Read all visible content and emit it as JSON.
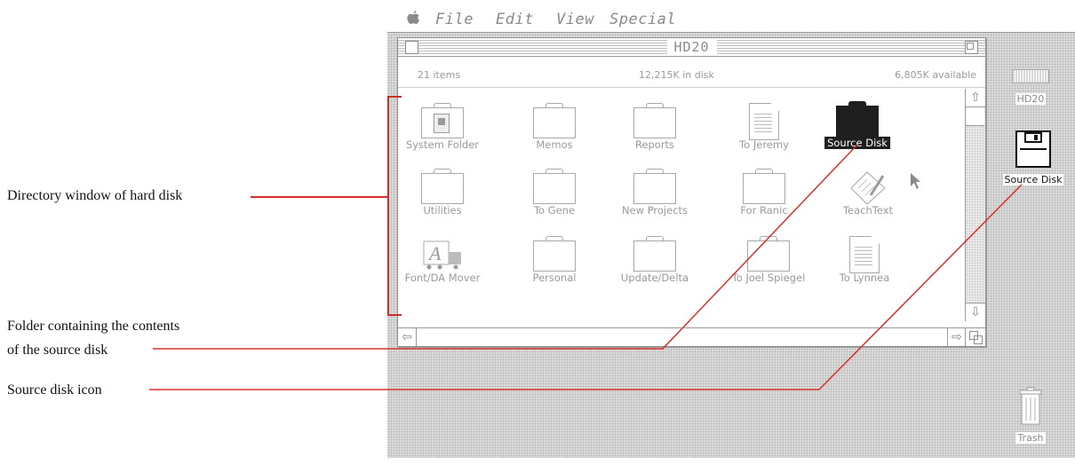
{
  "callouts": {
    "directory": "Directory window of hard disk",
    "folder_line1": "Folder containing the contents",
    "folder_line2": "of the source disk",
    "source_icon": "Source disk icon"
  },
  "menubar": {
    "apple_icon": "apple-logo-icon",
    "items": [
      "File",
      "Edit",
      "View",
      "Special"
    ]
  },
  "window": {
    "title": "HD20",
    "info": {
      "items": "21 items",
      "in_disk": "12,215K in disk",
      "available": "6,805K available"
    },
    "icons": [
      {
        "label": "System Folder",
        "icon": "system-folder-icon"
      },
      {
        "label": "Memos",
        "icon": "folder-icon"
      },
      {
        "label": "Reports",
        "icon": "folder-icon"
      },
      {
        "label": "To Jeremy",
        "icon": "document-icon"
      },
      {
        "label": "Source Disk",
        "icon": "folder-icon",
        "selected": true
      },
      {
        "label": "Utilities",
        "icon": "folder-icon"
      },
      {
        "label": "To Gene",
        "icon": "folder-icon"
      },
      {
        "label": "New Projects",
        "icon": "folder-icon"
      },
      {
        "label": "For Ranic",
        "icon": "folder-icon"
      },
      {
        "label": "TeachText",
        "icon": "teachtext-icon"
      },
      {
        "label": "Font/DA Mover",
        "icon": "font-da-mover-icon"
      },
      {
        "label": "Personal",
        "icon": "folder-icon"
      },
      {
        "label": "Update/Delta",
        "icon": "folder-icon"
      },
      {
        "label": "To Joel Spiegel",
        "icon": "folder-icon"
      },
      {
        "label": "To Lynnea",
        "icon": "document-icon"
      }
    ]
  },
  "desktop": {
    "hd20_label": "HD20",
    "source_disk_label": "Source Disk",
    "trash_label": "Trash"
  },
  "colors": {
    "callout_line": "#d8302a",
    "selection": "#1e1e1e"
  }
}
